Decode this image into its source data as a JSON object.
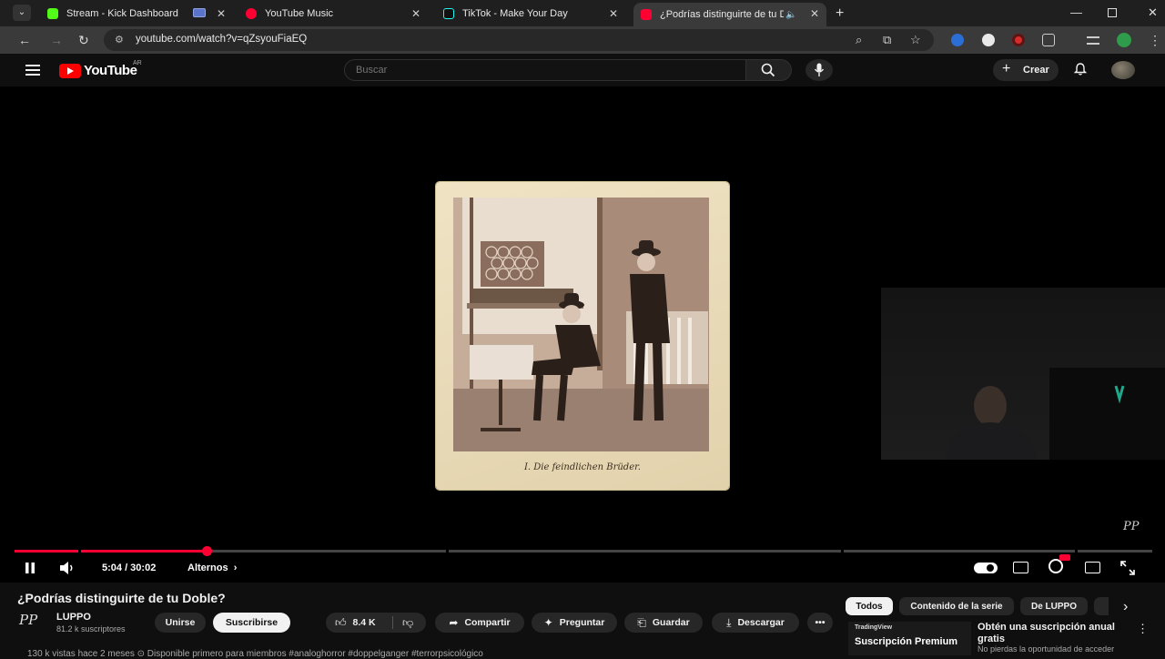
{
  "browser": {
    "tabs": [
      {
        "title": "Stream - Kick Dashboard",
        "favicon_color": "#53fc18"
      },
      {
        "title": "YouTube Music",
        "favicon_color": "#ff0033"
      },
      {
        "title": "TikTok - Make Your Day",
        "favicon_color": "#000000"
      },
      {
        "title": "¿Podrías distinguirte de tu D",
        "favicon_color": "#ff0033",
        "active": true
      }
    ],
    "url": "youtube.com/watch?v=qZsyouFiaEQ"
  },
  "masthead": {
    "logo_text": "YouTube",
    "country_code": "AR",
    "search_placeholder": "Buscar",
    "create_label": "Crear"
  },
  "player": {
    "photo_caption": "I. Die feindlichen Brüder.",
    "watermark": "PP",
    "current_time": "5:04",
    "duration": "30:02",
    "time_display": "5:04 / 30:02",
    "chapter_label": "Alternos",
    "progress_fraction": 0.169,
    "buffered_fraction": 0.169,
    "accent_color": "#ff0033"
  },
  "video": {
    "title": "¿Podrías distinguirte de tu Doble?",
    "channel_name": "LUPPO",
    "channel_avatar_text": "PP",
    "subscribers": "81.2 k suscriptores",
    "join_label": "Unirse",
    "subscribe_label": "Suscribirse",
    "likes": "8.4 K",
    "share_label": "Compartir",
    "ask_label": "Preguntar",
    "save_label": "Guardar",
    "download_label": "Descargar",
    "description_preview": "130 k vistas  hace 2 meses  ⊙ Disponible primero para miembros  #analoghorror #doppelganger #terrorpsicológico"
  },
  "sidebar": {
    "chips": [
      {
        "label": "Todos",
        "active": true
      },
      {
        "label": "Contenido de la serie",
        "active": false
      },
      {
        "label": "De LUPPO",
        "active": false
      }
    ],
    "ad": {
      "thumb_brand": "TradingView",
      "thumb_title": "Suscripción Premium",
      "title": "Obtén una suscripción anual gratis",
      "subtitle": "No pierdas la oportunidad de acceder"
    }
  }
}
